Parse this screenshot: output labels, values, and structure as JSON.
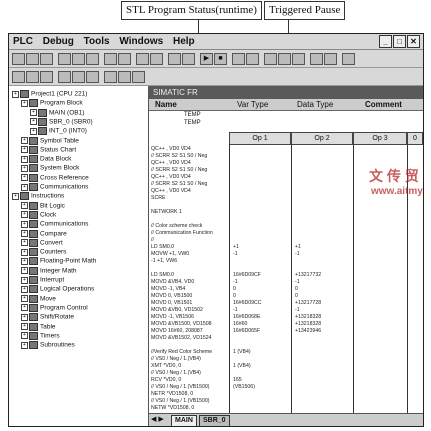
{
  "callouts": {
    "stl_status": "STL Program Status(runtime)",
    "triggered_pause": "Triggered Pause"
  },
  "menu": [
    "PLC",
    "Debug",
    "Tools",
    "Windows",
    "Help"
  ],
  "tree": [
    {
      "label": "Project1 (CPU 221)",
      "indent": 0
    },
    {
      "label": "Program Block",
      "indent": 1
    },
    {
      "label": "MAIN (OB1)",
      "indent": 2
    },
    {
      "label": "SBR_0 (SBR0)",
      "indent": 2
    },
    {
      "label": "INT_0 (INT0)",
      "indent": 2
    },
    {
      "label": "Symbol Table",
      "indent": 1
    },
    {
      "label": "Status Chart",
      "indent": 1
    },
    {
      "label": "Data Block",
      "indent": 1
    },
    {
      "label": "System Block",
      "indent": 1
    },
    {
      "label": "Cross Reference",
      "indent": 1
    },
    {
      "label": "Communications",
      "indent": 1
    },
    {
      "label": "Instructions",
      "indent": 0
    },
    {
      "label": "Bit Logic",
      "indent": 1
    },
    {
      "label": "Clock",
      "indent": 1
    },
    {
      "label": "Communications",
      "indent": 1
    },
    {
      "label": "Compare",
      "indent": 1
    },
    {
      "label": "Convert",
      "indent": 1
    },
    {
      "label": "Counters",
      "indent": 1
    },
    {
      "label": "Floating-Point Math",
      "indent": 1
    },
    {
      "label": "Integer Math",
      "indent": 1
    },
    {
      "label": "Interrupt",
      "indent": 1
    },
    {
      "label": "Logical Operations",
      "indent": 1
    },
    {
      "label": "Move",
      "indent": 1
    },
    {
      "label": "Program Control",
      "indent": 1
    },
    {
      "label": "Shift/Rotate",
      "indent": 1
    },
    {
      "label": "Table",
      "indent": 1
    },
    {
      "label": "Timers",
      "indent": 1
    },
    {
      "label": "Subroutines",
      "indent": 1
    }
  ],
  "symbol_table": {
    "title": "SIMATIC FR",
    "columns": [
      "Name",
      "Var Type",
      "Data Type",
      "Comment"
    ],
    "rows": [
      "TEMP",
      "TEMP"
    ]
  },
  "ladder_columns": [
    "Op 1",
    "Op 2",
    "Op 3",
    "0"
  ],
  "code_lines": [
    "QC++  , VD0   VD4",
    "// SCRR S2 S1 S0 / Neg",
    "QC++  , VD0   VD4",
    "// SCRR S2 S1 S0 / Neg",
    "QC++  , VD0   VD4",
    "// SCRR S2 S1 S0 / Neg",
    "QC++  , VD0   VD4",
    "SCRE",
    "",
    "NETWORK 1",
    "",
    "// Color scheme check",
    "// Communication Function",
    "//",
    "LD      SM0.0",
    "MOVW    +1, VW0",
    "-1      +1, VW6",
    "",
    "LD      SM0.0",
    "MOVD    &VB4, VD0",
    "MOVD    -1, VB4",
    "MOVD    0, VB1500",
    "MOVD    0, VB1501",
    "MOVD    &VB0, VD1502",
    "MOVD    -1, VB1506",
    "MOVD    &VB1500, VD1508",
    "MOVD    16#60, 208087",
    "MOVD    &VB1502, VD1524",
    "",
    "//Verify Red Color Scheme",
    "// VS0 / Neg / 1.(VB4)",
    "XMT     *VD0, 0",
    "// VS0 / Neg / 1.(VB4)",
    "RCV     *VD0, 0",
    "// VS0 / Neg / 1.(VB1500)",
    "NETR    *VD1508, 0",
    "// VS0 / Neg / 1.(VB1500)",
    "NETW    *VD1508, 0"
  ],
  "op1_values": [
    "+1",
    "-1",
    "",
    "",
    "16#6D09CF",
    "-1",
    "0",
    "0",
    "16#6D09CC",
    "-1",
    "16#6D068E",
    "16#60",
    "16#6D065F",
    "",
    "",
    "1 (VB4)",
    "",
    "1 (VB4)",
    "",
    "165",
    "(VB1506)"
  ],
  "op2_values": [
    "+1",
    "-1",
    "",
    "",
    "+13217732",
    "-1",
    "0",
    "0",
    "+13217728",
    "-1",
    "+13218328",
    "+13218328",
    "+13423946",
    "",
    "",
    "",
    "",
    "",
    "",
    "",
    ""
  ],
  "tabs": [
    "MAIN",
    "SBR_0"
  ],
  "watermark": {
    "main": "文 传 贸 易",
    "sub": "www.aitmy.com"
  },
  "colors": {
    "title_bar": "#5a5a5a",
    "window_bg": "#d8d8d8",
    "watermark": "#b42a2a"
  }
}
